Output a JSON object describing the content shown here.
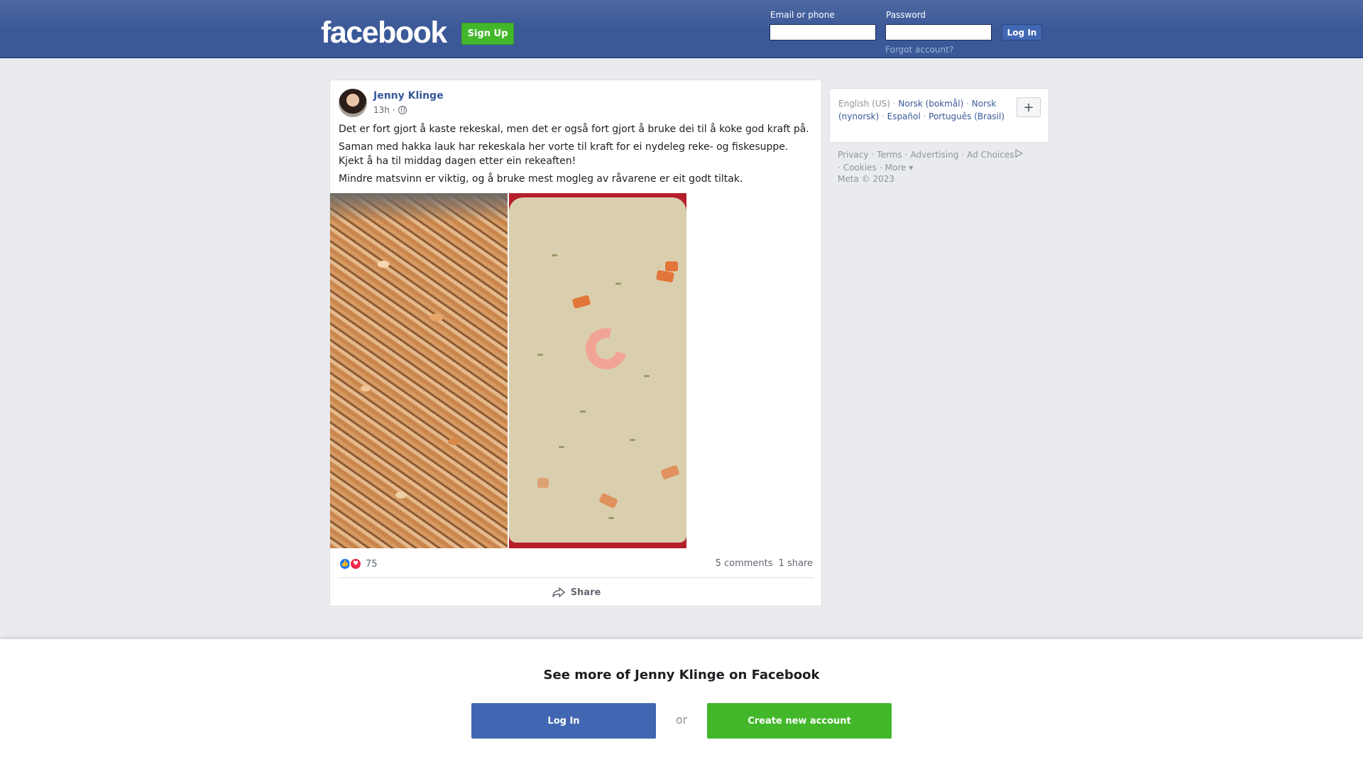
{
  "header": {
    "logo_text": "facebook",
    "signup_label": "Sign Up",
    "email_label": "Email or phone",
    "password_label": "Password",
    "login_label": "Log In",
    "forgot_label": "Forgot account?"
  },
  "post": {
    "author": "Jenny Klinge",
    "time": "13h ·",
    "paragraphs": [
      "Det er fort gjort å kaste rekeskal, men det er også fort gjort å bruke dei til å koke god kraft på.",
      "Saman med hakka lauk har rekeskala her vorte til kraft for ei nydeleg reke- og fiskesuppe.",
      "Kjekt å ha til middag dagen etter ein rekeaften!",
      "Mindre matsvinn er viktig, og å bruke mest mogleg av råvarene er eit godt tiltak."
    ],
    "reaction_count": "75",
    "comments": "5 comments",
    "shares": "1 share",
    "share_label": "Share"
  },
  "languages": {
    "current": "English (US)",
    "items": [
      "Norsk (bokmål)",
      "Norsk (nynorsk)",
      "Español",
      "Português (Brasil)"
    ],
    "more_label": "+"
  },
  "footer": {
    "links": [
      "Privacy",
      "Terms",
      "Advertising",
      "Ad Choices",
      "Cookies",
      "More"
    ],
    "copyright": "Meta © 2023"
  },
  "banner": {
    "title": "See more of Jenny Klinge on Facebook",
    "login_label": "Log In",
    "or_label": "or",
    "create_label": "Create new account"
  },
  "colors": {
    "brand_blue": "#4267b2",
    "header_blue": "#3b5998",
    "green": "#42b72a",
    "page_bg": "#e9ebee"
  },
  "icons": {
    "privacy": "globe-icon",
    "like": "like-reaction-icon",
    "love": "love-reaction-icon",
    "share": "share-arrow-icon",
    "ad_choices": "ad-choices-icon"
  }
}
